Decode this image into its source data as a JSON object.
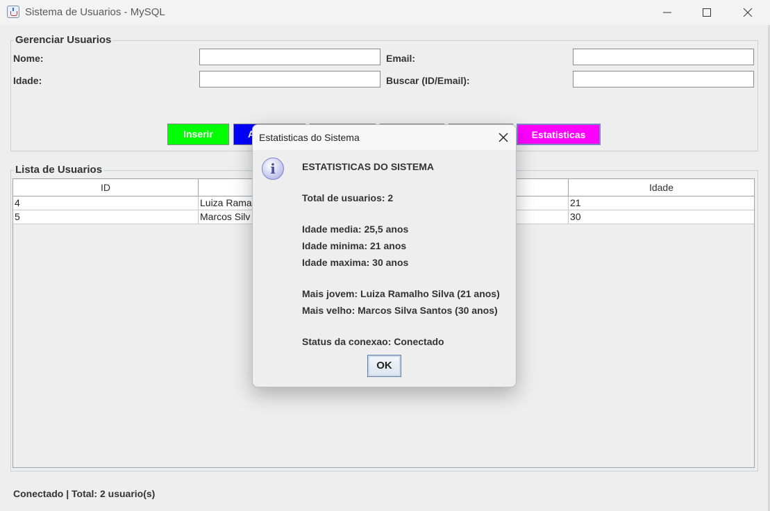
{
  "window": {
    "title": "Sistema de Usuarios - MySQL",
    "icon": "java-app-icon"
  },
  "manage_group": {
    "legend": "Gerenciar Usuarios",
    "fields": {
      "nome_label": "Nome:",
      "nome_value": "",
      "email_label": "Email:",
      "email_value": "",
      "idade_label": "Idade:",
      "idade_value": "",
      "buscar_label": "Buscar (ID/Email):",
      "buscar_value": ""
    },
    "buttons": [
      {
        "label": "Inserir",
        "color": "#00ff00"
      },
      {
        "label": "A",
        "color": "#0000ff"
      },
      {
        "label": "",
        "color": "#ff0000"
      },
      {
        "label": "",
        "color": "#ffff00"
      },
      {
        "label": "",
        "color": "#888888"
      },
      {
        "label": "Estatisticas",
        "color": "#ff00ff"
      }
    ]
  },
  "list_group": {
    "legend": "Lista de Usuarios",
    "columns": [
      "ID",
      "",
      "",
      "Idade"
    ],
    "rows": [
      {
        "id": "4",
        "nome": "Luiza Rama",
        "idade": "21"
      },
      {
        "id": "5",
        "nome": "Marcos Silv",
        "idade": "30"
      }
    ]
  },
  "status_bar": {
    "text": "Conectado | Total: 2 usuario(s)"
  },
  "dialog": {
    "title": "Estatisticas do Sistema",
    "icon": "info-icon",
    "lines": {
      "heading": "ESTATISTICAS DO SISTEMA",
      "total": "Total de usuarios: 2",
      "media": "Idade media: 25,5 anos",
      "minima": "Idade minima: 21 anos",
      "maxima": "Idade maxima: 30 anos",
      "jovem": "Mais jovem: Luiza Ramalho Silva (21 anos)",
      "velho": "Mais velho: Marcos Silva Santos (30 anos)",
      "status": "Status da conexao: Conectado"
    },
    "ok_label": "OK"
  }
}
